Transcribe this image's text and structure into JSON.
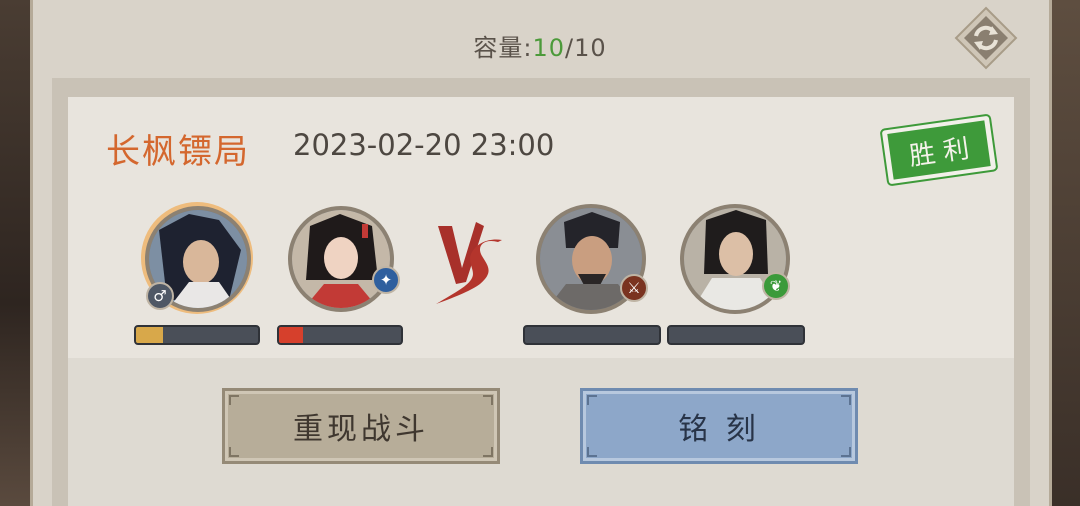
{
  "header": {
    "capacity_label": "容量:",
    "capacity_current": "10",
    "capacity_total": "/10"
  },
  "record": {
    "org_name": "长枫镖局",
    "datetime": "2023-02-20 23:00",
    "result_stamp": "胜 利",
    "vs_label": "VS"
  },
  "team_left": [
    {
      "badge_icon": "male-symbol-icon",
      "badge_glyph": "♂",
      "hp_percent": 22,
      "hp_color": "#d8a84a"
    },
    {
      "badge_icon": "blue-weapon-icon",
      "badge_glyph": "✦",
      "hp_percent": 20,
      "hp_color": "#d6402c"
    }
  ],
  "team_right": [
    {
      "badge_icon": "fire-blade-icon",
      "badge_glyph": "⚔",
      "hp_percent": 0,
      "hp_color": "#4a4f58"
    },
    {
      "badge_icon": "green-leaf-icon",
      "badge_glyph": "❦",
      "hp_percent": 0,
      "hp_color": "#4a4f58"
    }
  ],
  "buttons": {
    "replay_label": "重现战斗",
    "engrave_label": "铭 刻"
  },
  "colors": {
    "capacity_highlight": "#4c9a3a",
    "org_name": "#d4672e",
    "stamp_green": "#3e9a3a",
    "replay_button": "#b7ad99",
    "engrave_button": "#8da7c9"
  }
}
